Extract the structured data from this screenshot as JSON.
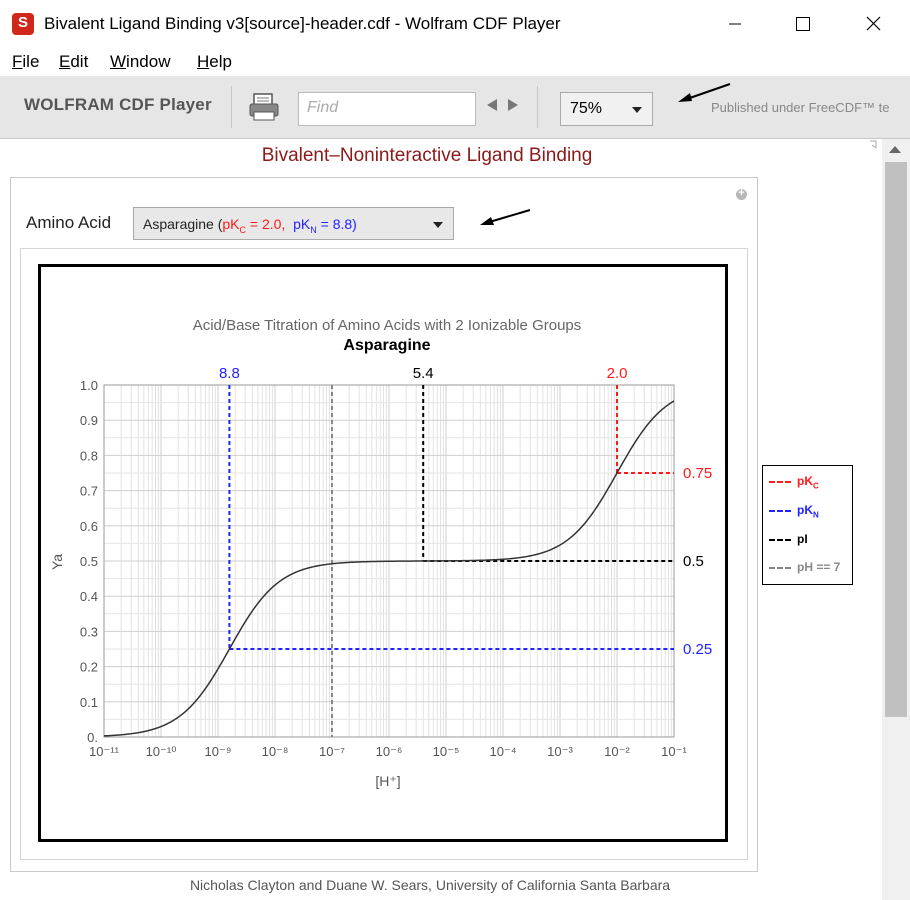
{
  "window": {
    "title": "Bivalent Ligand Binding v3[source]-header.cdf - Wolfram CDF Player",
    "app_icon_glyph": "S"
  },
  "menu": [
    "File",
    "Edit",
    "Window",
    "Help"
  ],
  "toolbar": {
    "brand": "WOLFRAM CDF Player",
    "find_placeholder": "Find",
    "zoom": "75%",
    "published": "Published under FreeCDF™ te"
  },
  "page": {
    "title": "Bivalent–Noninteractive Ligand Binding",
    "credit": "Nicholas Clayton and Duane W. Sears,  University of California Santa Barbara"
  },
  "control": {
    "label": "Amino Acid",
    "selected_name": "Asparagine (",
    "pkc_text": "pK",
    "pkc_sub": "C",
    "pkc_val": " = 2.0,",
    "pkn_text": "pK",
    "pkn_sub": "N",
    "pkn_val": " = 8.8)",
    "plus_glyph": "+"
  },
  "legend": [
    {
      "text": "pK",
      "sub": "C",
      "color": "#ff1a1a"
    },
    {
      "text": "pK",
      "sub": "N",
      "color": "#2222ff"
    },
    {
      "text": "pI",
      "sub": "",
      "color": "#000000"
    },
    {
      "text": "pH == 7",
      "sub": "",
      "color": "#888888"
    }
  ],
  "chart_data": {
    "type": "line",
    "title": "Acid/Base Titration of Amino Acids with 2 Ionizable Groups",
    "subtitle": "Asparagine",
    "xlabel": "[H⁺]",
    "ylabel": "Ya",
    "x_scale": "log",
    "xlim": [
      1e-11,
      0.1
    ],
    "ylim": [
      0,
      1.0
    ],
    "x_tick_labels": [
      "10⁻¹¹",
      "10⁻¹⁰",
      "10⁻⁹",
      "10⁻⁸",
      "10⁻⁷",
      "10⁻⁶",
      "10⁻⁵",
      "10⁻⁴",
      "10⁻³",
      "10⁻²",
      "10⁻¹"
    ],
    "y_tick_labels": [
      "0.",
      "0.1",
      "0.2",
      "0.3",
      "0.4",
      "0.5",
      "0.6",
      "0.7",
      "0.8",
      "0.9",
      "1.0"
    ],
    "pKC": 2.0,
    "pKN": 8.8,
    "pI": 5.4,
    "pH_neutral": 7,
    "top_labels": [
      {
        "text": "8.8",
        "pH": 8.8,
        "color": "#2222ff"
      },
      {
        "text": "5.4",
        "pH": 5.4,
        "color": "#000000"
      },
      {
        "text": "2.0",
        "pH": 2.0,
        "color": "#ff1a1a"
      }
    ],
    "right_labels": [
      {
        "text": "0.75",
        "y": 0.75,
        "color": "#ff1a1a"
      },
      {
        "text": "0.5",
        "y": 0.5,
        "color": "#000000"
      },
      {
        "text": "0.25",
        "y": 0.25,
        "color": "#2222ff"
      }
    ],
    "series": [
      {
        "color": "#333333",
        "equation": "Ya = 0.5*H/(H+10^-pKN) + 0.5*H/(H+10^-pKC)"
      }
    ],
    "grid": true
  }
}
